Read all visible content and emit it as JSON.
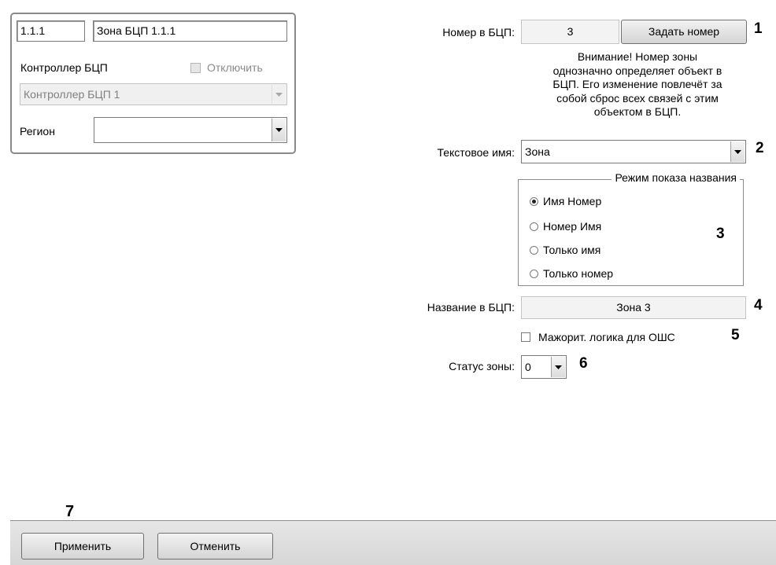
{
  "zone_panel": {
    "code": "1.1.1",
    "name": "Зона БЦП 1.1.1",
    "controller_label": "Контроллер БЦП",
    "disable_label": "Отключить",
    "controller_value": "Контроллер БЦП 1",
    "region_label": "Регион",
    "region_value": ""
  },
  "bcp_number": {
    "label": "Номер в БЦП:",
    "value": "3",
    "set_button": "Задать номер",
    "warning_lines": [
      "Внимание! Номер зоны",
      "однозначно определяет объект в",
      "БЦП. Его изменение повлечёт за",
      "собой сброс всех связей с этим",
      "объектом в БЦП."
    ]
  },
  "text_name": {
    "label": "Текстовое имя:",
    "value": "Зона"
  },
  "display_mode": {
    "legend": "Режим показа названия",
    "options": [
      "Имя Номер",
      "Номер Имя",
      "Только имя",
      "Только номер"
    ],
    "selected": "Имя Номер"
  },
  "bcp_name": {
    "label": "Название в БЦП:",
    "value": "Зона 3"
  },
  "majority_logic": {
    "label": "Мажорит. логика для ОШС",
    "checked": false
  },
  "zone_status": {
    "label": "Статус зоны:",
    "value": "0"
  },
  "markers": [
    "1",
    "2",
    "3",
    "4",
    "5",
    "6",
    "7"
  ],
  "footer": {
    "apply": "Применить",
    "cancel": "Отменить"
  },
  "colors": {
    "panel_border": "#8a8a8a",
    "footer_bg": "#dcdcdc"
  }
}
